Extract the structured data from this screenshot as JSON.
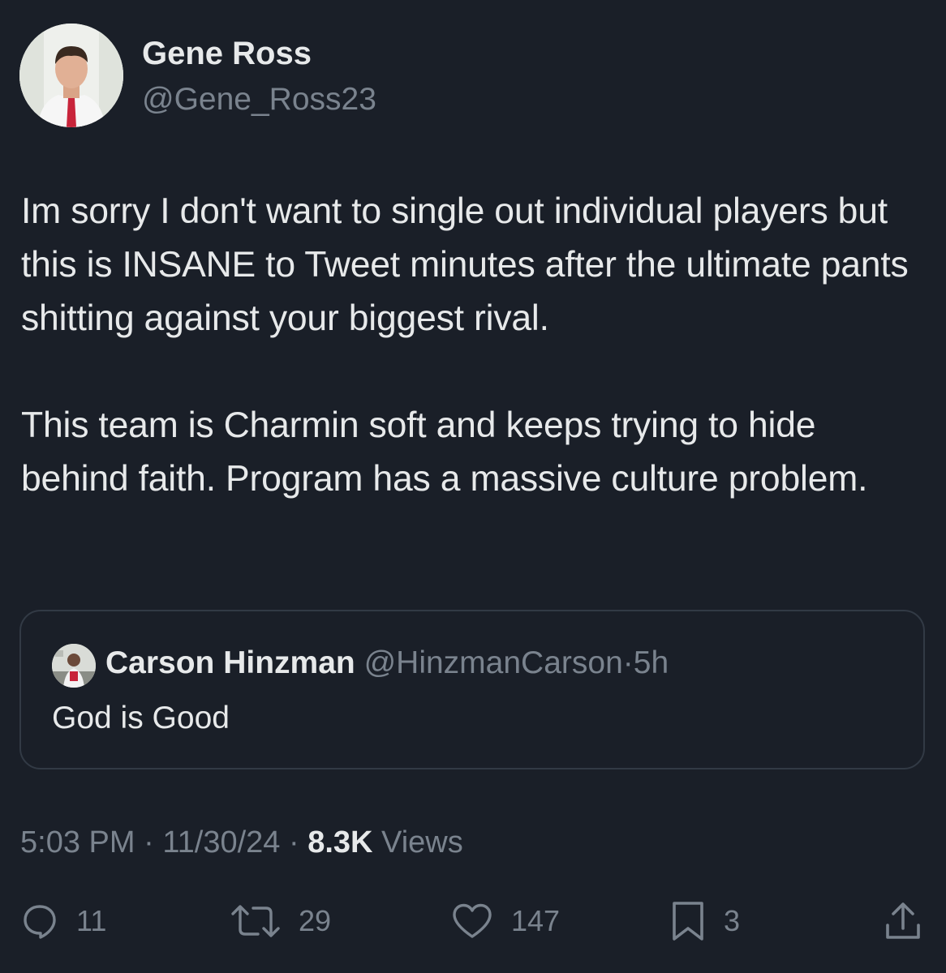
{
  "author": {
    "name": "Gene Ross",
    "handle": "@Gene_Ross23",
    "avatar_icon": "profile-photo"
  },
  "tweet": {
    "paragraphs": [
      "Im sorry I don't want to single out individual players but this is INSANE to Tweet minutes after the ultimate pants shitting against your biggest rival.",
      "This team is Charmin soft and keeps trying to hide behind faith. Program has a massive culture problem."
    ]
  },
  "quote": {
    "name": "Carson Hinzman",
    "handle": "@HinzmanCarson",
    "separator": "·",
    "time": "5h",
    "text": "God is Good",
    "avatar_icon": "profile-photo"
  },
  "meta": {
    "time": "5:03 PM",
    "separator": "·",
    "date": "11/30/24",
    "views_count": "8.3K",
    "views_label": "Views"
  },
  "actions": {
    "replies": "11",
    "retweets": "29",
    "likes": "147",
    "bookmarks": "3"
  },
  "colors": {
    "background": "#1a1f28",
    "primary_text": "#e7e9ea",
    "secondary_text": "#7a838e",
    "border": "#323a45"
  }
}
